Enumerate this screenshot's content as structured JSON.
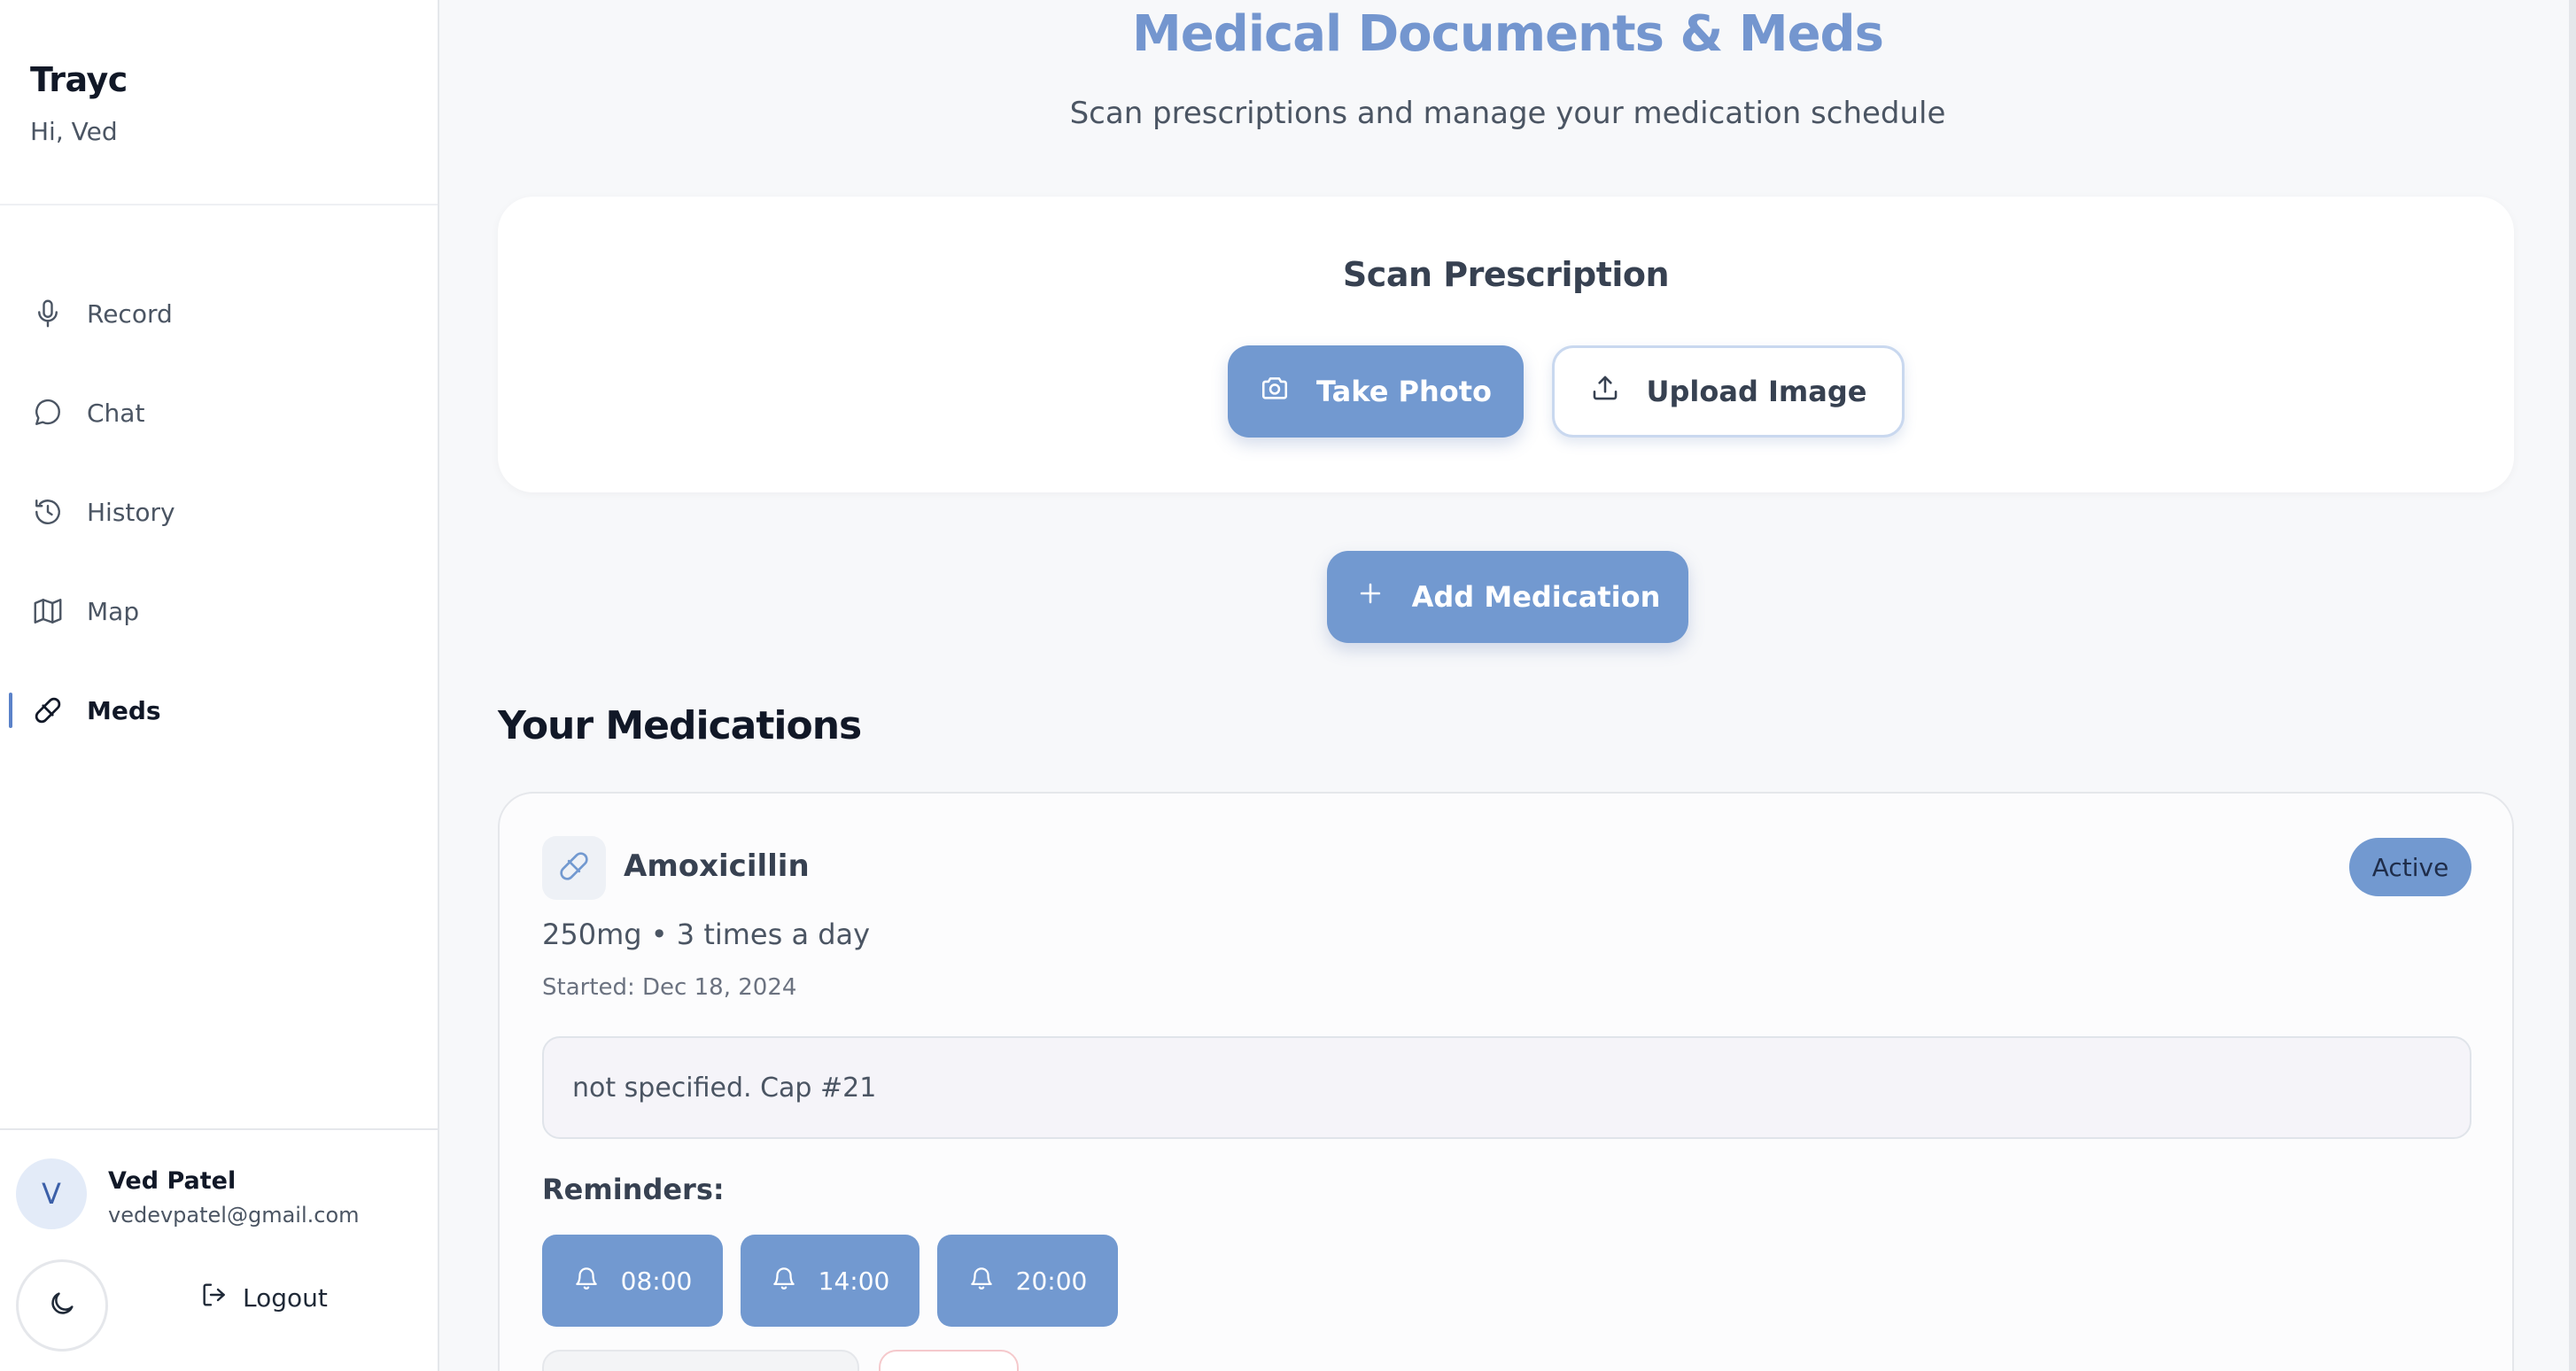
{
  "sidebar": {
    "brand_title": "Trayc",
    "greeting": "Hi, Ved",
    "items": [
      {
        "label": "Record",
        "icon": "mic-icon"
      },
      {
        "label": "Chat",
        "icon": "chat-bubble-icon"
      },
      {
        "label": "History",
        "icon": "history-icon"
      },
      {
        "label": "Map",
        "icon": "map-icon"
      },
      {
        "label": "Meds",
        "icon": "pill-icon",
        "active": true
      }
    ],
    "user": {
      "initial": "V",
      "name": "Ved Patel",
      "email": "vedevpatel@gmail.com"
    },
    "logout_label": "Logout",
    "theme_toggle_icon": "moon-icon"
  },
  "main": {
    "title": "Medical Documents & Meds",
    "subtitle": "Scan prescriptions and manage your medication schedule",
    "scan": {
      "title": "Scan Prescription",
      "take_photo_label": "Take Photo",
      "upload_label": "Upload Image"
    },
    "add_medication_label": "Add Medication",
    "section_title": "Your Medications",
    "medications": [
      {
        "name": "Amoxicillin",
        "status": "Active",
        "dose": "250mg • 3 times a day",
        "started": "Started: Dec 18, 2024",
        "notes": "not specified. Cap #21",
        "reminders_label": "Reminders:",
        "reminders": [
          "08:00",
          "14:00",
          "20:00"
        ]
      }
    ]
  },
  "colors": {
    "accent": "#7299d0",
    "title": "#7496cf",
    "active_indicator": "#5b82c9"
  }
}
